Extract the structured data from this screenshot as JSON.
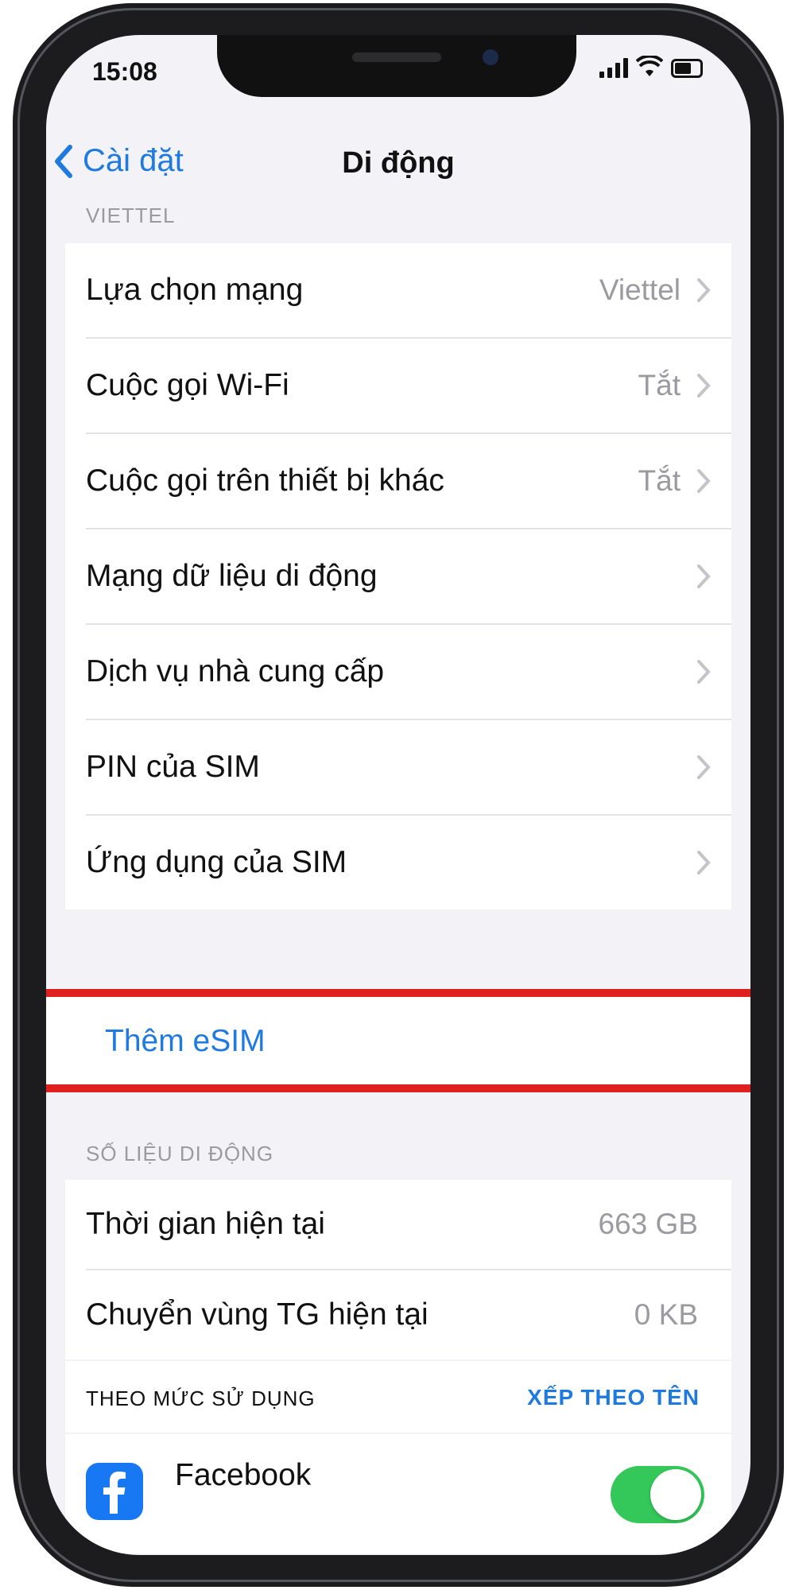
{
  "status_bar": {
    "time": "15:08"
  },
  "nav": {
    "back_label": "Cài đặt",
    "title": "Di động"
  },
  "carrier_section": {
    "header": "VIETTEL",
    "rows": [
      {
        "label": "Lựa chọn mạng",
        "value": "Viettel"
      },
      {
        "label": "Cuộc gọi Wi-Fi",
        "value": "Tắt"
      },
      {
        "label": "Cuộc gọi trên thiết bị khác",
        "value": "Tắt"
      },
      {
        "label": "Mạng dữ liệu di động",
        "value": ""
      },
      {
        "label": "Dịch vụ nhà cung cấp",
        "value": ""
      },
      {
        "label": "PIN của SIM",
        "value": ""
      },
      {
        "label": "Ứng dụng của SIM",
        "value": ""
      }
    ]
  },
  "esim": {
    "label": "Thêm eSIM"
  },
  "data_section": {
    "header": "SỐ LIỆU DI ĐỘNG",
    "rows": [
      {
        "label": "Thời gian hiện tại",
        "value": "663 GB"
      },
      {
        "label": "Chuyển vùng TG hiện tại",
        "value": "0 KB"
      }
    ]
  },
  "sort": {
    "label": "THEO MỨC SỬ DỤNG",
    "action": "XẾP THEO TÊN"
  },
  "apps": [
    {
      "name": "Facebook",
      "sub": ""
    }
  ],
  "colors": {
    "accent": "#1f7ae0",
    "highlight": "#e0201e",
    "toggle_on": "#34c759"
  }
}
